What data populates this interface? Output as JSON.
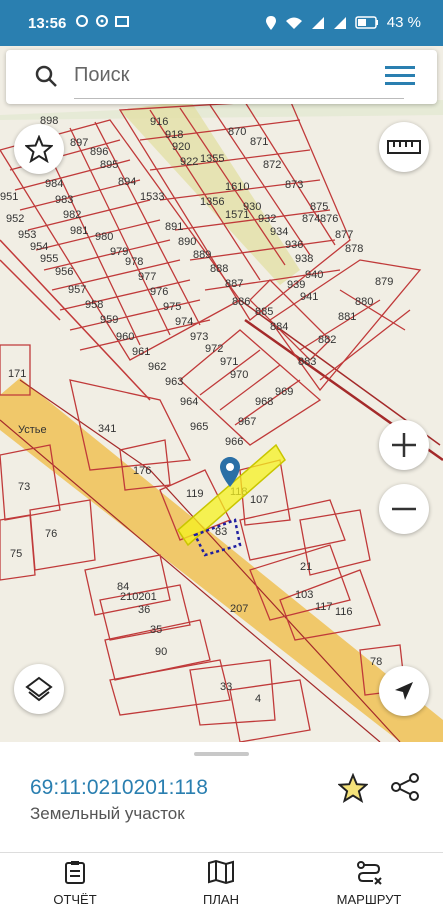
{
  "status_bar": {
    "time": "13:56",
    "battery": "43 %"
  },
  "search": {
    "placeholder": "Поиск"
  },
  "map": {
    "parcel_labels": [
      "898",
      "897",
      "896",
      "895",
      "894",
      "984",
      "983",
      "982",
      "981",
      "980",
      "979",
      "978",
      "977",
      "976",
      "975",
      "974",
      "973",
      "972",
      "971",
      "970",
      "969",
      "968",
      "967",
      "966",
      "965",
      "964",
      "963",
      "962",
      "961",
      "960",
      "959",
      "958",
      "957",
      "956",
      "955",
      "954",
      "953",
      "952",
      "951",
      "1533",
      "891",
      "890",
      "889",
      "888",
      "887",
      "886",
      "885",
      "884",
      "883",
      "882",
      "881",
      "880",
      "879",
      "878",
      "877",
      "876",
      "875",
      "874",
      "873",
      "872",
      "871",
      "870",
      "1355",
      "1356",
      "1610",
      "1571",
      "930",
      "932",
      "934",
      "936",
      "938",
      "939",
      "940",
      "941",
      "916",
      "918",
      "920",
      "922",
      "171",
      "341",
      "176",
      "119",
      "118",
      "107",
      "83",
      "73",
      "76",
      "75",
      "84",
      "36",
      "35",
      "90",
      "33",
      "4",
      "21",
      "103",
      "117",
      "116",
      "78",
      "207"
    ],
    "block_label": "210201",
    "locality_label": "Устье",
    "highlighted_parcel": "118"
  },
  "selection": {
    "cadastral_number": "69:11:0210201:118",
    "object_type": "Земельный участок"
  },
  "nav": {
    "report": "ОТЧЁТ",
    "plan": "ПЛАН",
    "route": "МАРШРУТ"
  }
}
